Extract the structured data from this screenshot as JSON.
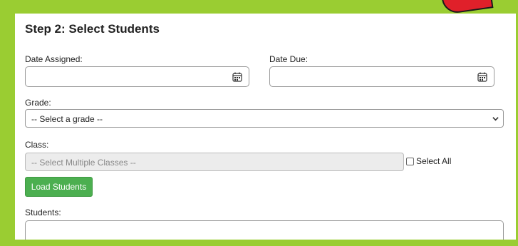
{
  "page": {
    "title": "Step 2: Select Students"
  },
  "form": {
    "date_assigned_label": "Date Assigned:",
    "date_due_label": "Date Due:",
    "date_assigned_value": "",
    "date_due_value": "",
    "grade_label": "Grade:",
    "grade_selected": "-- Select a grade --",
    "class_label": "Class:",
    "class_placeholder": "-- Select Multiple Classes --",
    "select_all_label": "Select All",
    "load_button_label": "Load Students",
    "students_label": "Students:"
  },
  "colors": {
    "frame": "#9acd32",
    "button": "#4caf50"
  },
  "icons": {
    "date_assigned": "calendar-icon",
    "date_due": "calendar-icon",
    "grade_select": "chevron-down-icon"
  }
}
